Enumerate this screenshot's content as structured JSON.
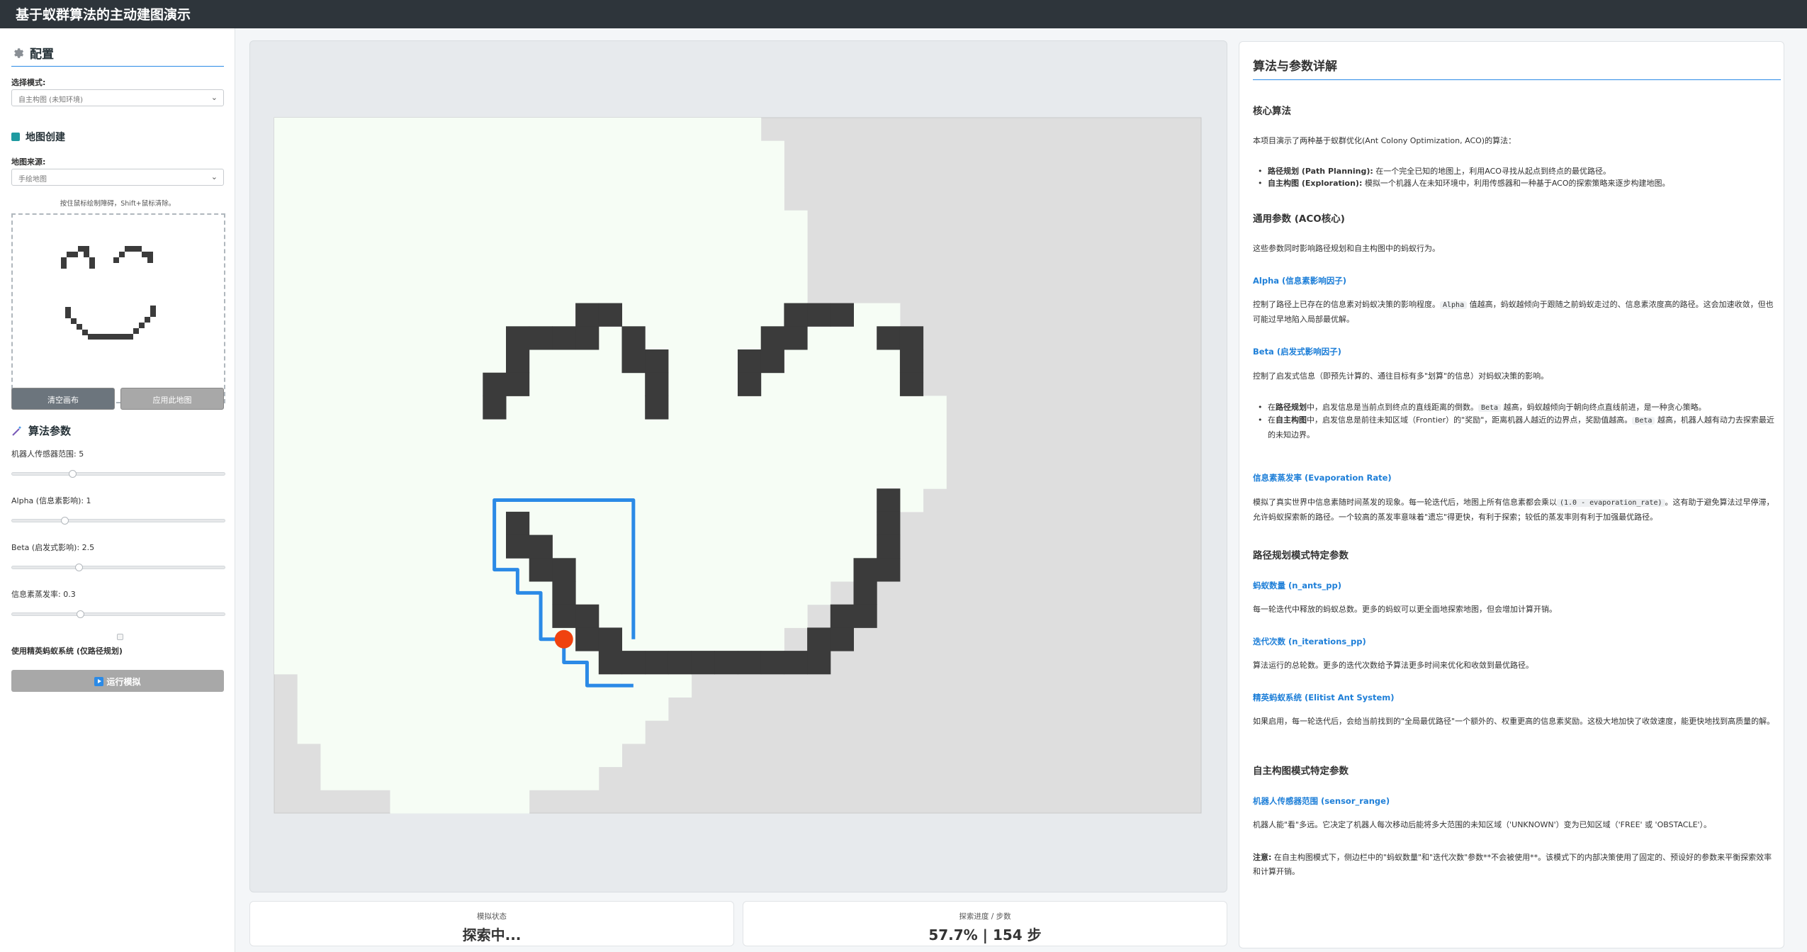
{
  "app": {
    "title": "基于蚁群算法的主动建图演示"
  },
  "sidebar": {
    "config_title": "配置",
    "mode_label": "选择模式:",
    "mode_value": "自主构图 (未知环境)",
    "map_section_title": "地图创建",
    "map_source_label": "地图来源:",
    "map_source_value": "手绘地图",
    "draw_hint": "按住鼠标绘制障碍，Shift+鼠标清除。",
    "clear_button": "清空画布",
    "apply_button": "应用此地图",
    "algo_section_title": "算法参数",
    "params": [
      {
        "label": "机器人传感器范围: 5",
        "value": 5,
        "min": 1,
        "max": 20
      },
      {
        "label": "Alpha (信息素影响): 1",
        "value": 1,
        "min": 0,
        "max": 5
      },
      {
        "label": "Beta (启发式影响): 2.5",
        "value": 2.5,
        "min": 0,
        "max": 8
      },
      {
        "label": "信息素蒸发率: 0.3",
        "value": 0.3,
        "min": 0,
        "max": 1
      }
    ],
    "elitist_checkbox": {
      "label": "使用精英蚂蚁系统 (仅路径规划)",
      "checked": true
    },
    "run_button": "运行模拟"
  },
  "status": {
    "sim_state_label": "模拟状态",
    "sim_state_value": "探索中...",
    "progress_label": "探索进度 / 步数",
    "progress_value": "57.7% | 154 步"
  },
  "info": {
    "title": "算法与参数详解",
    "core_title": "核心算法",
    "core_intro": "本项目演示了两种基于蚁群优化(Ant Colony Optimization, ACO)的算法：",
    "core_items": [
      {
        "term": "路径规划 (Path Planning):",
        "desc": " 在一个完全已知的地图上，利用ACO寻找从起点到终点的最优路径。"
      },
      {
        "term": "自主构图 (Exploration):",
        "desc": " 模拟一个机器人在未知环境中，利用传感器和一种基于ACO的探索策略来逐步构建地图。"
      }
    ],
    "common_title": "通用参数 (ACO核心)",
    "common_intro": "这些参数同时影响路径规划和自主构图中的蚂蚁行为。",
    "alpha_title": "Alpha (信息素影响因子)",
    "alpha_p1": "控制了路径上已存在的信息素对蚂蚁决策的影响程度。",
    "alpha_code": "Alpha",
    "alpha_p2": " 值越高，蚂蚁越倾向于跟随之前蚂蚁走过的、信息素浓度高的路径。这会加速收敛，但也可能过早地陷入局部最优解。",
    "beta_title": "Beta (启发式影响因子)",
    "beta_desc": "控制了启发式信息（即预先计算的、通往目标有多\"划算\"的信息）对蚂蚁决策的影响。",
    "beta_items": [
      {
        "pre": "在",
        "term": "路径规划",
        "mid": "中，启发信息是当前点到终点的直线距离的倒数。",
        "code": "Beta",
        "post": " 越高，蚂蚁越倾向于朝向终点直线前进，是一种贪心策略。"
      },
      {
        "pre": "在",
        "term": "自主构图",
        "mid": "中，启发信息是前往未知区域（Frontier）的\"奖励\"，距离机器人越近的边界点，奖励值越高。",
        "code": "Beta",
        "post": " 越高，机器人越有动力去探索最近的未知边界。"
      }
    ],
    "evap_title": "信息素蒸发率 (Evaporation Rate)",
    "evap_p1": "模拟了真实世界中信息素随时间蒸发的现象。每一轮迭代后，地图上所有信息素都会乘以",
    "evap_code": "(1.0 - evaporation_rate)",
    "evap_p2": "。这有助于避免算法过早停滞，允许蚂蚁探索新的路径。一个较高的蒸发率意味着\"遗忘\"得更快，有利于探索；较低的蒸发率则有利于加强最优路径。",
    "pp_title": "路径规划模式特定参数",
    "nants_title": "蚂蚁数量 (n_ants_pp)",
    "nants_desc": "每一轮迭代中释放的蚂蚁总数。更多的蚂蚁可以更全面地探索地图，但会增加计算开销。",
    "niter_title": "迭代次数 (n_iterations_pp)",
    "niter_desc": "算法运行的总轮数。更多的迭代次数给予算法更多时间来优化和收敛到最优路径。",
    "elitist_title": "精英蚂蚁系统 (Elitist Ant System)",
    "elitist_desc": "如果启用，每一轮迭代后，会给当前找到的\"全局最优路径\"一个额外的、权重更高的信息素奖励。这极大地加快了收敛速度，能更快地找到高质量的解。",
    "exp_title": "自主构图模式特定参数",
    "sensor_title": "机器人传感器范围 (sensor_range)",
    "sensor_desc": "机器人能\"看\"多远。它决定了机器人每次移动后能将多大范围的未知区域（'UNKNOWN'）变为已知区域（'FREE' 或 'OBSTACLE'）。",
    "note_label": "注意:",
    "note_desc": " 在自主构图模式下，侧边栏中的\"蚂蚁数量\"和\"迭代次数\"参数**不会被使用**。该模式下的内部决策使用了固定的、预设好的参数来平衡探索效率和计算开销。"
  },
  "colors": {
    "topbar": "#2e353b",
    "accent": "#2b8ae6",
    "free": "#f6fdf5",
    "unknown": "#dedede",
    "obstacle": "#3b3b3b",
    "path": "#2b8ae6",
    "robot": "#f0420f"
  },
  "icons": {
    "config": "gear-icon",
    "map": "map-icon",
    "algo": "wand-icon",
    "run": "play-icon"
  }
}
